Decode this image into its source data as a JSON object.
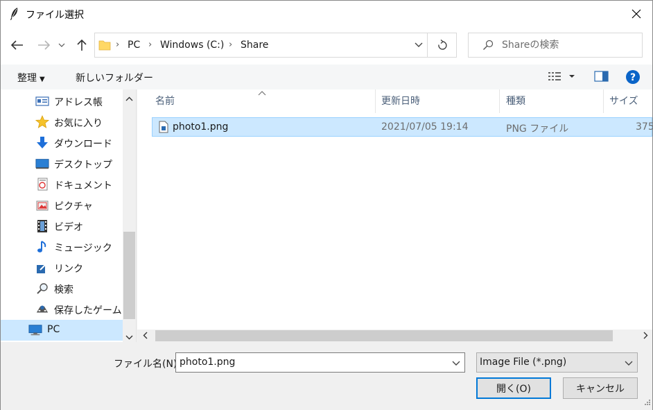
{
  "window": {
    "title": "ファイル選択",
    "app_icon": "feather-icon",
    "close_icon": "close-icon"
  },
  "nav": {
    "back_icon": "arrow-left-icon",
    "forward_icon": "arrow-right-icon",
    "recent_icon": "chevron-down-icon",
    "up_icon": "arrow-up-icon",
    "breadcrumbs": [
      "PC",
      "Windows (C:)",
      "Share"
    ],
    "refresh_icon": "refresh-icon",
    "search_placeholder": "Shareの検索"
  },
  "commands": {
    "organize": "整理",
    "new_folder": "新しいフォルダー",
    "view_icon": "view-details-icon",
    "preview_icon": "preview-pane-icon",
    "help_icon": "help-icon"
  },
  "sidebar": {
    "items": [
      {
        "label": "アドレス帳",
        "icon": "contacts-icon"
      },
      {
        "label": "お気に入り",
        "icon": "star-icon"
      },
      {
        "label": "ダウンロード",
        "icon": "download-icon"
      },
      {
        "label": "デスクトップ",
        "icon": "desktop-icon"
      },
      {
        "label": "ドキュメント",
        "icon": "documents-icon"
      },
      {
        "label": "ピクチャ",
        "icon": "pictures-icon"
      },
      {
        "label": "ビデオ",
        "icon": "video-icon"
      },
      {
        "label": "ミュージック",
        "icon": "music-icon"
      },
      {
        "label": "リンク",
        "icon": "link-icon"
      },
      {
        "label": "検索",
        "icon": "search-icon"
      },
      {
        "label": "保存したゲーム",
        "icon": "games-icon"
      },
      {
        "label": "PC",
        "icon": "computer-icon"
      }
    ]
  },
  "files": {
    "columns": [
      "名前",
      "更新日時",
      "種類",
      "サイズ"
    ],
    "rows": [
      {
        "name": "photo1.png",
        "modified": "2021/07/05 19:14",
        "type": "PNG ファイル",
        "size": "375"
      }
    ]
  },
  "footer": {
    "filename_label": "ファイル名(N):",
    "filename_value": "photo1.png",
    "filetype_value": "Image File (*.png)",
    "open_label": "開く(O)",
    "cancel_label": "キャンセル"
  },
  "colors": {
    "selection": "#cce8ff",
    "selection_border": "#99d1ff",
    "accent": "#0078d7",
    "header_text": "#4c607a"
  }
}
